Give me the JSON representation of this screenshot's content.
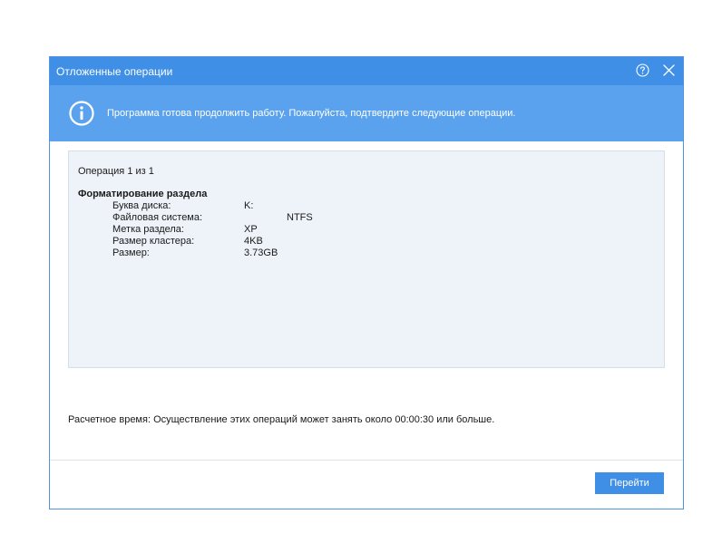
{
  "dialog": {
    "title": "Отложенные операции",
    "help_icon": "help-circle-icon",
    "close_icon": "close-icon"
  },
  "banner": {
    "icon": "info-circle-icon",
    "message": "Программа готова продолжить работу. Пожалуйста, подтвердите следующие операции."
  },
  "operations": {
    "counter": "Операция 1 из 1",
    "heading": "Форматирование раздела",
    "fields": [
      {
        "label": "Буква диска:",
        "value": "K:"
      },
      {
        "label": "Файловая система:",
        "value": "NTFS"
      },
      {
        "label": "Метка раздела:",
        "value": "XP"
      },
      {
        "label": "Размер кластера:",
        "value": "4KB"
      },
      {
        "label": "Размер:",
        "value": "3.73GB"
      }
    ]
  },
  "estimate": "Расчетное время: Осуществление этих операций может занять около 00:00:30 или больше.",
  "buttons": {
    "go_label": "Перейти"
  },
  "colors": {
    "titlebar": "#3f8fe6",
    "banner": "#5aa2ee",
    "panel": "#eef3f9",
    "button": "#3f8fe6"
  }
}
